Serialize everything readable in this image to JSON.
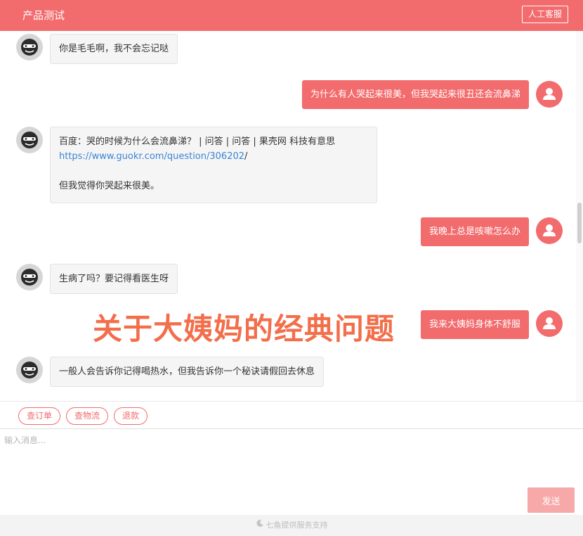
{
  "header": {
    "title": "产品测试",
    "service_button": "人工客服"
  },
  "messages": [
    {
      "from": "bot",
      "text": "你是毛毛啊，我不会忘记哒"
    },
    {
      "from": "user",
      "text": "为什么有人哭起来很美，但我哭起来很丑还会流鼻涕"
    },
    {
      "from": "bot",
      "line1": "百度：哭的时候为什么会流鼻涕？ | 问答 | 问答 | 果壳网 科技有意思",
      "link": "https://www.guokr.com/question/306202",
      "link_suffix": "/",
      "line3": "但我觉得你哭起来很美。"
    },
    {
      "from": "user",
      "text": "我晚上总是咳嗽怎么办"
    },
    {
      "from": "bot",
      "text": "生病了吗？要记得看医生呀"
    },
    {
      "from": "user",
      "text": "我来大姨妈身体不舒服"
    },
    {
      "from": "bot",
      "text": "一般人会告诉你记得喝热水，但我告诉你一个秘诀请假回去休息"
    }
  ],
  "overlay_caption": "关于大姨妈的经典问题",
  "quick_actions": [
    "查订单",
    "查物流",
    "退款"
  ],
  "composer": {
    "placeholder": "输入消息...",
    "send_label": "发送"
  },
  "footer": {
    "text": "七鱼提供服务支持"
  },
  "colors": {
    "accent": "#f26b6d",
    "send_disabled": "#f7a9aa",
    "overlay": "#f36e4a",
    "link": "#3a84d3"
  },
  "icons": {
    "bot_avatar": "robot-face-icon",
    "user_avatar": "user-silhouette-icon",
    "footer_logo": "moon-logo-icon"
  }
}
